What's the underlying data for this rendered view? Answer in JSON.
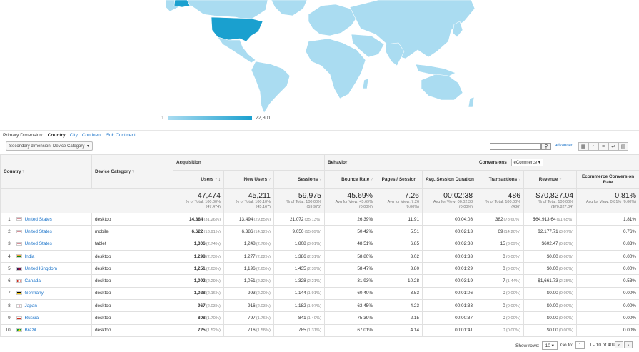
{
  "colors": {
    "map_light": "#aadcf1",
    "map_dark": "#1aa0cf",
    "link": "#1a73c9",
    "ocean": "#ffffff"
  },
  "legend": {
    "min": "1",
    "max": "22,801"
  },
  "dimensions": {
    "label": "Primary Dimension:",
    "active": "Country",
    "options": [
      "City",
      "Continent",
      "Sub Continent"
    ]
  },
  "toolbar": {
    "secondary_dimension": "Secondary dimension: Device Category",
    "search_placeholder": "",
    "advanced": "advanced",
    "view_icons": [
      "table-view-icon",
      "pie-view-icon",
      "performance-view-icon",
      "comparison-view-icon",
      "pivot-view-icon"
    ]
  },
  "table": {
    "groups": {
      "acquisition": "Acquisition",
      "behavior": "Behavior",
      "conversions": "Conversions",
      "conversion_select": "eCommerce"
    },
    "headers": {
      "country": "Country",
      "device": "Device Category",
      "users": "Users",
      "new_users": "New Users",
      "sessions": "Sessions",
      "bounce": "Bounce Rate",
      "pages": "Pages / Session",
      "duration": "Avg. Session Duration",
      "transactions": "Transactions",
      "revenue": "Revenue",
      "conv_rate": "Ecommerce Conversion Rate"
    },
    "totals": {
      "users": {
        "value": "47,474",
        "sub1": "% of Total: 100.00%",
        "sub2": "(47,474)"
      },
      "new_users": {
        "value": "45,211",
        "sub1": "% of Total: 100.10%",
        "sub2": "(45,167)"
      },
      "sessions": {
        "value": "59,975",
        "sub1": "% of Total: 100.00%",
        "sub2": "(59,975)"
      },
      "bounce": {
        "value": "45.69%",
        "sub1": "Avg for View: 45.69%",
        "sub2": "(0.00%)"
      },
      "pages": {
        "value": "7.26",
        "sub1": "Avg for View: 7.26",
        "sub2": "(0.00%)"
      },
      "duration": {
        "value": "00:02:38",
        "sub1": "Avg for View: 00:02:38",
        "sub2": "(0.00%)"
      },
      "transactions": {
        "value": "486",
        "sub1": "% of Total: 100.00%",
        "sub2": "(486)"
      },
      "revenue": {
        "value": "$70,827.04",
        "sub1": "% of Total: 100.00%",
        "sub2": "($70,827.04)"
      },
      "conv_rate": {
        "value": "0.81%",
        "sub1": "Avg for View: 0.81% (0.00%)",
        "sub2": ""
      }
    },
    "rows": [
      {
        "idx": "1.",
        "country": "United States",
        "flag": "us",
        "device": "desktop",
        "users": "14,884",
        "users_pct": "(31.26%)",
        "new_users": "13,494",
        "new_users_pct": "(29.85%)",
        "sessions": "21,072",
        "sessions_pct": "(35.13%)",
        "bounce": "26.39%",
        "pages": "11.91",
        "duration": "00:04:08",
        "transactions": "382",
        "transactions_pct": "(78.60%)",
        "revenue": "$64,913.64",
        "revenue_pct": "(91.65%)",
        "conv_rate": "1.81%"
      },
      {
        "idx": "2.",
        "country": "United States",
        "flag": "us",
        "device": "mobile",
        "users": "6,622",
        "users_pct": "(13.91%)",
        "new_users": "6,386",
        "new_users_pct": "(14.12%)",
        "sessions": "9,050",
        "sessions_pct": "(15.09%)",
        "bounce": "50.42%",
        "pages": "5.51",
        "duration": "00:02:13",
        "transactions": "69",
        "transactions_pct": "(14.20%)",
        "revenue": "$2,177.71",
        "revenue_pct": "(3.07%)",
        "conv_rate": "0.76%"
      },
      {
        "idx": "3.",
        "country": "United States",
        "flag": "us",
        "device": "tablet",
        "users": "1,306",
        "users_pct": "(2.74%)",
        "new_users": "1,248",
        "new_users_pct": "(2.76%)",
        "sessions": "1,808",
        "sessions_pct": "(3.01%)",
        "bounce": "48.51%",
        "pages": "6.85",
        "duration": "00:02:38",
        "transactions": "15",
        "transactions_pct": "(3.09%)",
        "revenue": "$602.47",
        "revenue_pct": "(0.85%)",
        "conv_rate": "0.83%"
      },
      {
        "idx": "4.",
        "country": "India",
        "flag": "in",
        "device": "desktop",
        "users": "1,298",
        "users_pct": "(2.73%)",
        "new_users": "1,277",
        "new_users_pct": "(2.82%)",
        "sessions": "1,386",
        "sessions_pct": "(2.31%)",
        "bounce": "58.80%",
        "pages": "3.02",
        "duration": "00:01:33",
        "transactions": "0",
        "transactions_pct": "(0.00%)",
        "revenue": "$0.00",
        "revenue_pct": "(0.00%)",
        "conv_rate": "0.00%"
      },
      {
        "idx": "5.",
        "country": "United Kingdom",
        "flag": "gb",
        "device": "desktop",
        "users": "1,251",
        "users_pct": "(2.63%)",
        "new_users": "1,196",
        "new_users_pct": "(2.65%)",
        "sessions": "1,435",
        "sessions_pct": "(2.39%)",
        "bounce": "58.47%",
        "pages": "3.80",
        "duration": "00:01:29",
        "transactions": "0",
        "transactions_pct": "(0.00%)",
        "revenue": "$0.00",
        "revenue_pct": "(0.00%)",
        "conv_rate": "0.00%"
      },
      {
        "idx": "6.",
        "country": "Canada",
        "flag": "ca",
        "device": "desktop",
        "users": "1,092",
        "users_pct": "(2.29%)",
        "new_users": "1,051",
        "new_users_pct": "(2.32%)",
        "sessions": "1,328",
        "sessions_pct": "(2.21%)",
        "bounce": "31.93%",
        "pages": "10.28",
        "duration": "00:03:19",
        "transactions": "7",
        "transactions_pct": "(1.44%)",
        "revenue": "$1,661.73",
        "revenue_pct": "(2.35%)",
        "conv_rate": "0.53%"
      },
      {
        "idx": "7.",
        "country": "Germany",
        "flag": "de",
        "device": "desktop",
        "users": "1,028",
        "users_pct": "(2.16%)",
        "new_users": "993",
        "new_users_pct": "(2.20%)",
        "sessions": "1,144",
        "sessions_pct": "(1.91%)",
        "bounce": "60.40%",
        "pages": "3.53",
        "duration": "00:01:06",
        "transactions": "0",
        "transactions_pct": "(0.00%)",
        "revenue": "$0.00",
        "revenue_pct": "(0.00%)",
        "conv_rate": "0.00%"
      },
      {
        "idx": "8.",
        "country": "Japan",
        "flag": "jp",
        "device": "desktop",
        "users": "967",
        "users_pct": "(2.03%)",
        "new_users": "916",
        "new_users_pct": "(2.03%)",
        "sessions": "1,182",
        "sessions_pct": "(1.97%)",
        "bounce": "63.45%",
        "pages": "4.23",
        "duration": "00:01:33",
        "transactions": "0",
        "transactions_pct": "(0.00%)",
        "revenue": "$0.00",
        "revenue_pct": "(0.00%)",
        "conv_rate": "0.00%"
      },
      {
        "idx": "9.",
        "country": "Russia",
        "flag": "ru",
        "device": "desktop",
        "users": "808",
        "users_pct": "(1.70%)",
        "new_users": "797",
        "new_users_pct": "(1.76%)",
        "sessions": "841",
        "sessions_pct": "(1.40%)",
        "bounce": "75.39%",
        "pages": "2.15",
        "duration": "00:00:37",
        "transactions": "0",
        "transactions_pct": "(0.00%)",
        "revenue": "$0.00",
        "revenue_pct": "(0.00%)",
        "conv_rate": "0.00%"
      },
      {
        "idx": "10.",
        "country": "Brazil",
        "flag": "br",
        "device": "desktop",
        "users": "725",
        "users_pct": "(1.52%)",
        "new_users": "716",
        "new_users_pct": "(1.58%)",
        "sessions": "785",
        "sessions_pct": "(1.31%)",
        "bounce": "67.01%",
        "pages": "4.14",
        "duration": "00:01:41",
        "transactions": "0",
        "transactions_pct": "(0.00%)",
        "revenue": "$0.00",
        "revenue_pct": "(0.00%)",
        "conv_rate": "0.00%"
      }
    ]
  },
  "footer": {
    "show_rows_label": "Show rows:",
    "show_rows": "10",
    "goto_label": "Go to:",
    "goto": "1",
    "range": "1 - 10 of 409"
  }
}
